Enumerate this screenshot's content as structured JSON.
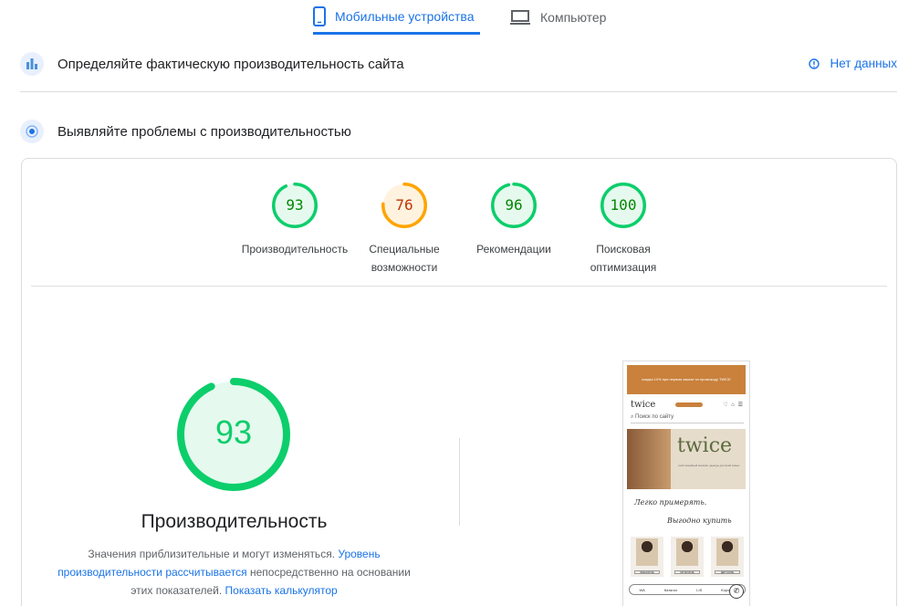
{
  "tabs": {
    "mobile": "Мобильные устройства",
    "desktop": "Компьютер"
  },
  "field_data": {
    "title": "Определяйте фактическую производительность сайта",
    "no_data": "Нет данных"
  },
  "lab": {
    "title": "Выявляйте проблемы с производительностью"
  },
  "scores": [
    {
      "value": "93",
      "label": "Производительность",
      "fraction": 0.93,
      "color": "#0cce6b",
      "text_color": "#008800",
      "bg": "#e6f9ee"
    },
    {
      "value": "76",
      "label": "Специальные возможности",
      "fraction": 0.76,
      "color": "#ffa400",
      "text_color": "#c33300",
      "bg": "#fff3e0"
    },
    {
      "value": "96",
      "label": "Рекомендации",
      "fraction": 0.96,
      "color": "#0cce6b",
      "text_color": "#008800",
      "bg": "#e6f9ee"
    },
    {
      "value": "100",
      "label": "Поисковая оптимизация",
      "fraction": 1.0,
      "color": "#0cce6b",
      "text_color": "#008800",
      "bg": "#e6f9ee"
    }
  ],
  "main_score": {
    "value": "93",
    "fraction": 0.93,
    "title": "Производительность",
    "desc_1": "Значения приблизительные и могут изменяться.",
    "link_1": "Уровень производительности рассчитывается",
    "desc_2": "непосредственно на основании этих показателей.",
    "link_2": "Показать калькулятор"
  },
  "colors": {
    "accent": "#1a73e8",
    "pass": "#0cce6b",
    "average": "#ffa400",
    "promo_bar": "#c9813c"
  },
  "thumbnail": {
    "promo": "скидка 10% при первом заказе по промокоду TWICE",
    "logo": "twice",
    "search": "Поиск по сайту",
    "hero_logo": "twice",
    "hero_text": "твой семейный магазин одежды для всей семьи",
    "script_1": "Легко примерять.",
    "script_2": "Выгодно купить",
    "cards": [
      "ЖЕНСКОЕ",
      "МУЖСКОЕ",
      "ДЕТСКОЕ"
    ],
    "bottom": [
      "WA",
      "Каталог",
      "LIS",
      "Корзина"
    ]
  }
}
